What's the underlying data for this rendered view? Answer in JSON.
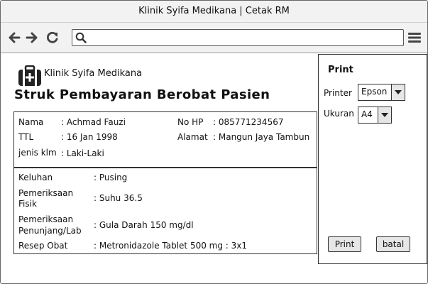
{
  "window": {
    "title": "Klinik Syifa Medikana | Cetak RM"
  },
  "browser": {
    "url_value": ""
  },
  "header": {
    "clinic_name": "Klinik Syifa Medikana",
    "page_title": "Struk Pembayaran Berobat Pasien"
  },
  "patient": {
    "nama_label": "Nama",
    "nama_value": ": Achmad Fauzi",
    "ttl_label": "TTL",
    "ttl_value": ": 16 Jan 1998",
    "jk_label": "jenis klm",
    "jk_value": ": Laki-Laki",
    "hp_label": "No HP",
    "hp_value": ": 085771234567",
    "alamat_label": "Alamat",
    "alamat_value": ": Mangun Jaya Tambun"
  },
  "details": {
    "keluhan_label": "Keluhan",
    "keluhan_value": ": Pusing",
    "fisik_label_1": "Pemeriksaan",
    "fisik_label_2": "Fisik",
    "fisik_value": ": Suhu 36.5",
    "penunjang_label_1": "Pemeriksaan",
    "penunjang_label_2": "Penunjang/Lab",
    "penunjang_value": ": Gula Darah 150 mg/dl",
    "resep_label": "Resep Obat",
    "resep_value": ": Metronidazole Tablet 500 mg : 3x1"
  },
  "print_panel": {
    "title": "Print",
    "printer_label": "Printer",
    "printer_value": "Epson",
    "ukuran_label": "Ukuran",
    "ukuran_value": "A4",
    "print_button": "Print",
    "cancel_button": "batal"
  },
  "icons": {
    "back": "arrow-left-icon",
    "forward": "arrow-right-icon",
    "reload": "reload-icon",
    "search": "search-icon",
    "menu": "hamburger-menu-icon",
    "clinic": "medical-kit-icon"
  }
}
